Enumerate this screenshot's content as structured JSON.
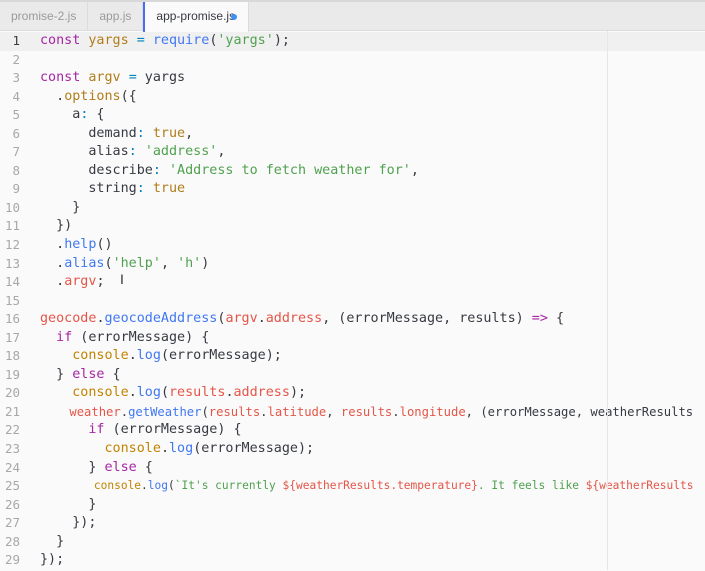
{
  "tabs": [
    {
      "label": "promise-2.js"
    },
    {
      "label": "app.js"
    },
    {
      "label": "app-promise.js",
      "active": true,
      "modified": true
    }
  ],
  "editor": {
    "current_line": 1,
    "lines": [
      [
        [
          "const",
          "k"
        ],
        [
          " "
        ],
        [
          "yargs",
          "v"
        ],
        [
          " "
        ],
        [
          "=",
          "p"
        ],
        [
          " "
        ],
        [
          "require",
          "f"
        ],
        [
          "("
        ],
        [
          "'yargs'",
          "s"
        ],
        [
          ");"
        ]
      ],
      [],
      [
        [
          "const",
          "k"
        ],
        [
          " "
        ],
        [
          "argv",
          "v"
        ],
        [
          " "
        ],
        [
          "=",
          "p"
        ],
        [
          " yargs"
        ]
      ],
      [
        [
          "  ."
        ],
        [
          "options",
          "v"
        ],
        [
          "({"
        ]
      ],
      [
        [
          "    a"
        ],
        [
          ":",
          "p"
        ],
        [
          " {"
        ]
      ],
      [
        [
          "      demand"
        ],
        [
          ":",
          "p"
        ],
        [
          " "
        ],
        [
          "true",
          "v"
        ],
        [
          ","
        ]
      ],
      [
        [
          "      alias"
        ],
        [
          ":",
          "p"
        ],
        [
          " "
        ],
        [
          "'address'",
          "s"
        ],
        [
          ","
        ]
      ],
      [
        [
          "      describe"
        ],
        [
          ":",
          "p"
        ],
        [
          " "
        ],
        [
          "'Address to fetch weather for'",
          "s"
        ],
        [
          ","
        ]
      ],
      [
        [
          "      string"
        ],
        [
          ":",
          "p"
        ],
        [
          " "
        ],
        [
          "true",
          "v"
        ]
      ],
      [
        [
          "    }"
        ]
      ],
      [
        [
          "  })"
        ]
      ],
      [
        [
          "  ."
        ],
        [
          "help",
          "f"
        ],
        [
          "()"
        ]
      ],
      [
        [
          "  ."
        ],
        [
          "alias",
          "f"
        ],
        [
          "("
        ],
        [
          "'help'",
          "s"
        ],
        [
          ", "
        ],
        [
          "'h'",
          "s"
        ],
        [
          ")"
        ]
      ],
      [
        [
          "  ."
        ],
        [
          "argv",
          "r"
        ],
        [
          ";"
        ]
      ],
      [],
      [
        [
          "geocode",
          "r"
        ],
        [
          "."
        ],
        [
          "geocodeAddress",
          "f"
        ],
        [
          "("
        ],
        [
          "argv",
          "r"
        ],
        [
          "."
        ],
        [
          "address",
          "r"
        ],
        [
          ", (errorMessage, results) "
        ],
        [
          "=>",
          "k"
        ],
        [
          " {"
        ]
      ],
      [
        [
          "  "
        ],
        [
          "if",
          "k"
        ],
        [
          " (errorMessage) {"
        ]
      ],
      [
        [
          "    "
        ],
        [
          "console",
          "c"
        ],
        [
          "."
        ],
        [
          "log",
          "f"
        ],
        [
          "(errorMessage);"
        ]
      ],
      [
        [
          "  } "
        ],
        [
          "else",
          "k"
        ],
        [
          " {"
        ]
      ],
      [
        [
          "    "
        ],
        [
          "console",
          "c"
        ],
        [
          "."
        ],
        [
          "log",
          "f"
        ],
        [
          "("
        ],
        [
          "results",
          "r"
        ],
        [
          "."
        ],
        [
          "address",
          "r"
        ],
        [
          ");"
        ]
      ],
      [
        [
          "    "
        ],
        [
          "weather",
          "r"
        ],
        [
          "."
        ],
        [
          "getWeather",
          "f"
        ],
        [
          "("
        ],
        [
          "results",
          "r"
        ],
        [
          "."
        ],
        [
          "latitude",
          "r"
        ],
        [
          ", "
        ],
        [
          "results",
          "r"
        ],
        [
          "."
        ],
        [
          "longitude",
          "r"
        ],
        [
          ", (errorMessage, weatherResults"
        ]
      ],
      [
        [
          "      "
        ],
        [
          "if",
          "k"
        ],
        [
          " (errorMessage) {"
        ]
      ],
      [
        [
          "        "
        ],
        [
          "console",
          "c"
        ],
        [
          "."
        ],
        [
          "log",
          "f"
        ],
        [
          "(errorMessage);"
        ]
      ],
      [
        [
          "      } "
        ],
        [
          "else",
          "k"
        ],
        [
          " {"
        ]
      ],
      [
        [
          "        "
        ],
        [
          "console",
          "c"
        ],
        [
          "."
        ],
        [
          "log",
          "f"
        ],
        [
          "("
        ],
        [
          "`It's currently ",
          "s"
        ],
        [
          "${",
          "r"
        ],
        [
          "weatherResults.temperature",
          "r"
        ],
        [
          "}",
          "r"
        ],
        [
          ". It feels like ",
          "s"
        ],
        [
          "${weatherResults",
          "r"
        ]
      ],
      [
        [
          "      }"
        ]
      ],
      [
        [
          "    });"
        ]
      ],
      [
        [
          "  }"
        ]
      ],
      [
        [
          "});"
        ]
      ]
    ]
  }
}
